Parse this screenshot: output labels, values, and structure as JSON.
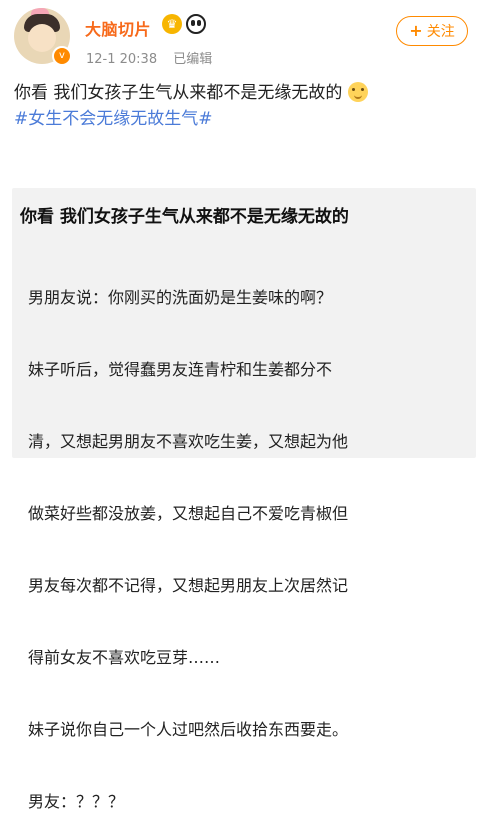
{
  "header": {
    "username": "大脑切片",
    "time": "12-1 20:38",
    "edited": "已编辑",
    "follow_label": "关注",
    "follow_icon": "+",
    "verified_icon": "v",
    "badges": [
      "crown-badge-icon",
      "panda-badge-icon"
    ]
  },
  "post": {
    "text": "你看 我们女孩子生气从来都不是无缘无故的",
    "hashtag": "#女生不会无缘无故生气#",
    "emoji": "happy-face-emoji"
  },
  "image": {
    "title": "你看 我们女孩子生气从来都不是无缘无故的",
    "lines": [
      "男朋友说：你刚买的洗面奶是生姜味的啊？",
      "妹子听后，觉得蠢男友连青柠和生姜都分不",
      "清，又想起男朋友不喜欢吃生姜，又想起为他",
      "做菜好些都没放姜，又想起自己不爱吃青椒但",
      "男友每次都不记得，又想起男朋友上次居然记",
      "得前女友不喜欢吃豆芽……",
      "妹子说你自己一个人过吧然后收拾东西要走。",
      "男友：？？？"
    ]
  },
  "colors": {
    "username": "#f76a1b",
    "follow": "#ff8a00",
    "hashtag": "#4b7bd8",
    "meta": "#8c8c8c"
  }
}
